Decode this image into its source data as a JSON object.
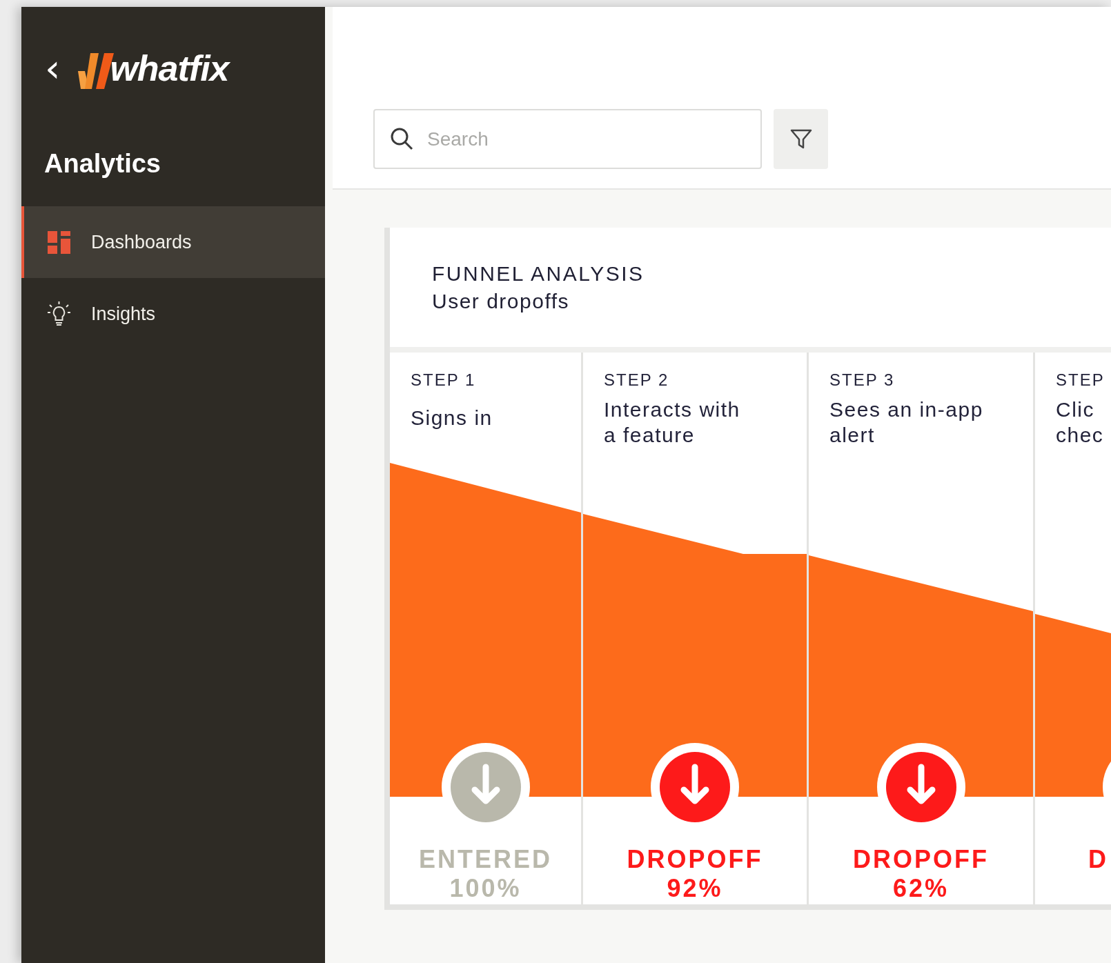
{
  "sidebar": {
    "back": "‹",
    "logo": "whatfix",
    "section_title": "Analytics",
    "items": [
      {
        "label": "Dashboards",
        "kind": "dashboards",
        "selected": true
      },
      {
        "label": "Insights",
        "kind": "insights",
        "selected": false
      }
    ]
  },
  "toolbar": {
    "search": {
      "placeholder": "Search"
    }
  },
  "funnel": {
    "title": "FUNNEL ANALYSIS",
    "subtitle": "User dropoffs",
    "steps": [
      {
        "label": "STEP 1",
        "name": [
          "Signs in"
        ],
        "kind": "entered",
        "status": "ENTERED",
        "percent": "100%"
      },
      {
        "label": "STEP 2",
        "name": [
          "Interacts with",
          "a feature"
        ],
        "kind": "dropoff",
        "status": "DROPOFF",
        "percent": "92%"
      },
      {
        "label": "STEP 3",
        "name": [
          "Sees an in-app",
          "alert"
        ],
        "kind": "dropoff",
        "status": "DROPOFF",
        "percent": "62%"
      },
      {
        "label": "STEP",
        "name": [
          "Clic",
          "chec"
        ],
        "kind": "dropoff",
        "status": "D"
      }
    ]
  }
}
